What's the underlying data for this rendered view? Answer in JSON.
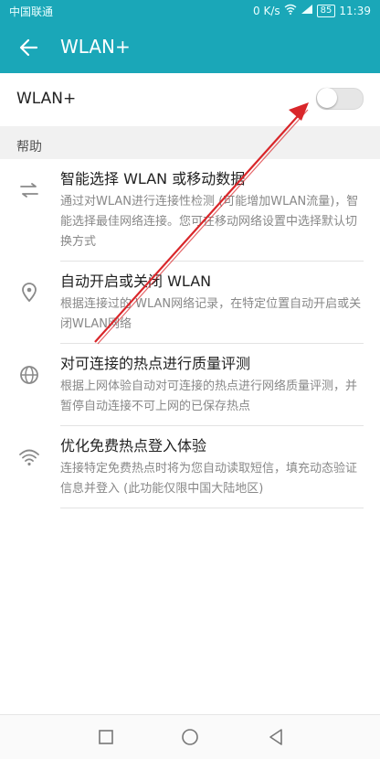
{
  "status": {
    "carrier": "中国联通",
    "speed": "0 K/s",
    "battery": "85",
    "time": "11:39"
  },
  "appbar": {
    "title": "WLAN+"
  },
  "toggle": {
    "label": "WLAN+",
    "state": "off"
  },
  "section": {
    "title": "帮助"
  },
  "items": [
    {
      "title": "智能选择 WLAN 或移动数据",
      "desc": "通过对WLAN进行连接性检测 (可能增加WLAN流量)，智能选择最佳网络连接。您可在移动网络设置中选择默认切换方式",
      "icon": "swap-icon"
    },
    {
      "title": "自动开启或关闭 WLAN",
      "desc": "根据连接过的 WLAN网络记录，在特定位置自动开启或关闭WLAN网络",
      "icon": "location-icon"
    },
    {
      "title": "对可连接的热点进行质量评测",
      "desc": "根据上网体验自动对可连接的热点进行网络质量评测，并暂停自动连接不可上网的已保存热点",
      "icon": "globe-icon"
    },
    {
      "title": "优化免费热点登入体验",
      "desc": "连接特定免费热点时将为您自动读取短信，填充动态验证信息并登入 (此功能仅限中国大陆地区)",
      "icon": "wifi-icon"
    }
  ],
  "colors": {
    "accent": "#1aa7b8",
    "annotation": "#d9262a"
  }
}
